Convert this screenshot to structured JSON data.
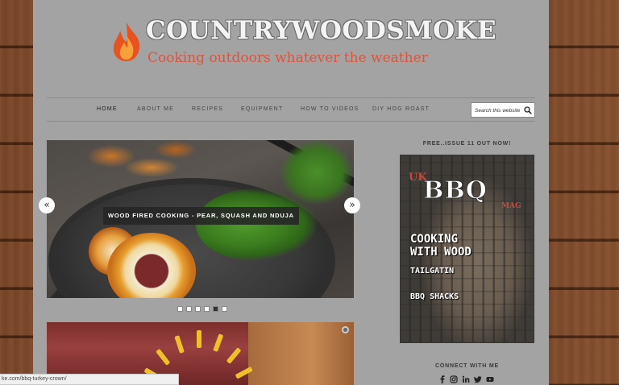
{
  "header": {
    "site_title": "COUNTRYWOODSMOKE",
    "tagline": "Cooking outdoors whatever the weather"
  },
  "nav": {
    "items": [
      {
        "label": "HOME",
        "active": true
      },
      {
        "label": "ABOUT ME",
        "active": false
      },
      {
        "label": "RECIPES",
        "active": false
      },
      {
        "label": "EQUIPMENT",
        "active": false
      },
      {
        "label": "HOW TO VIDEOS",
        "active": false
      },
      {
        "label": "DIY HOG ROAST",
        "active": false
      }
    ],
    "search": {
      "placeholder": "Search this website",
      "icon": "search-icon"
    }
  },
  "slider": {
    "caption": "WOOD FIRED COOKING - PEAR, SQUASH AND NDUJA",
    "prev_label": "«",
    "next_label": "»",
    "slide_count": 6,
    "active_slide": 5
  },
  "sidebar": {
    "issue_title": "FREE..ISSUE 11 OUT NOW!",
    "magazine": {
      "brand_prefix": "UK",
      "brand": "BBQ",
      "brand_suffix": "MAG",
      "headline1": "COOKING",
      "headline2": "WITH WOOD",
      "subhead1": "TAILGATIN",
      "subhead2": "BBQ SHACKS"
    },
    "connect_title": "CONNECT WITH ME",
    "social_icons": [
      "facebook-icon",
      "instagram-icon",
      "linkedin-icon",
      "twitter-icon",
      "youtube-icon"
    ]
  },
  "status_bar": {
    "url": "ke.com/bbq-turkey-crown/"
  },
  "colors": {
    "page_bg": "#a3a3a3",
    "accent": "#d9563e",
    "flame": "#e8521f"
  }
}
